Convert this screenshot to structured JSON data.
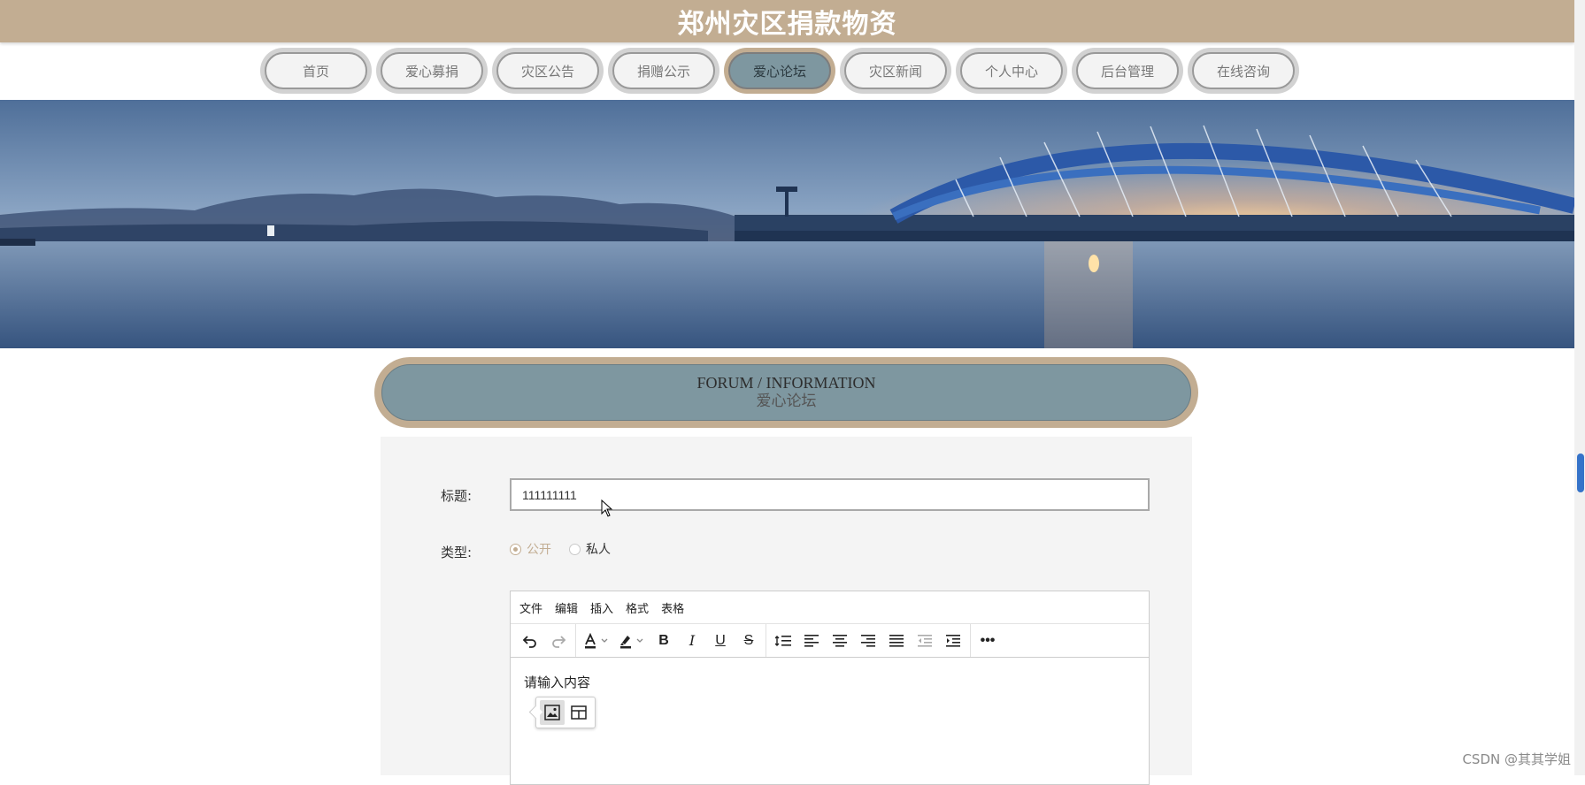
{
  "header": {
    "title": "郑州灾区捐款物资"
  },
  "nav": {
    "items": [
      {
        "label": "首页"
      },
      {
        "label": "爱心募捐"
      },
      {
        "label": "灾区公告"
      },
      {
        "label": "捐赠公示"
      },
      {
        "label": "爱心论坛",
        "active": true
      },
      {
        "label": "灾区新闻"
      },
      {
        "label": "个人中心"
      },
      {
        "label": "后台管理"
      },
      {
        "label": "在线咨询"
      }
    ]
  },
  "banner": {
    "icon": "bridge-sunset-photo"
  },
  "section": {
    "title_en": "FORUM / INFORMATION",
    "title_cn": "爱心论坛"
  },
  "form": {
    "title_label": "标题:",
    "title_value": "111111111",
    "type_label": "类型:",
    "type_options": [
      {
        "label": "公开",
        "checked": true
      },
      {
        "label": "私人",
        "checked": false
      }
    ]
  },
  "editor": {
    "menu": [
      "文件",
      "编辑",
      "插入",
      "格式",
      "表格"
    ],
    "placeholder": "请输入内容",
    "quick_icons": [
      "image-icon",
      "table-icon"
    ]
  },
  "colors": {
    "accent": "#c2ad92",
    "active_fill": "#7e97a0",
    "panel_bg": "#f4f4f4"
  },
  "watermark": "CSDN @其其学姐"
}
